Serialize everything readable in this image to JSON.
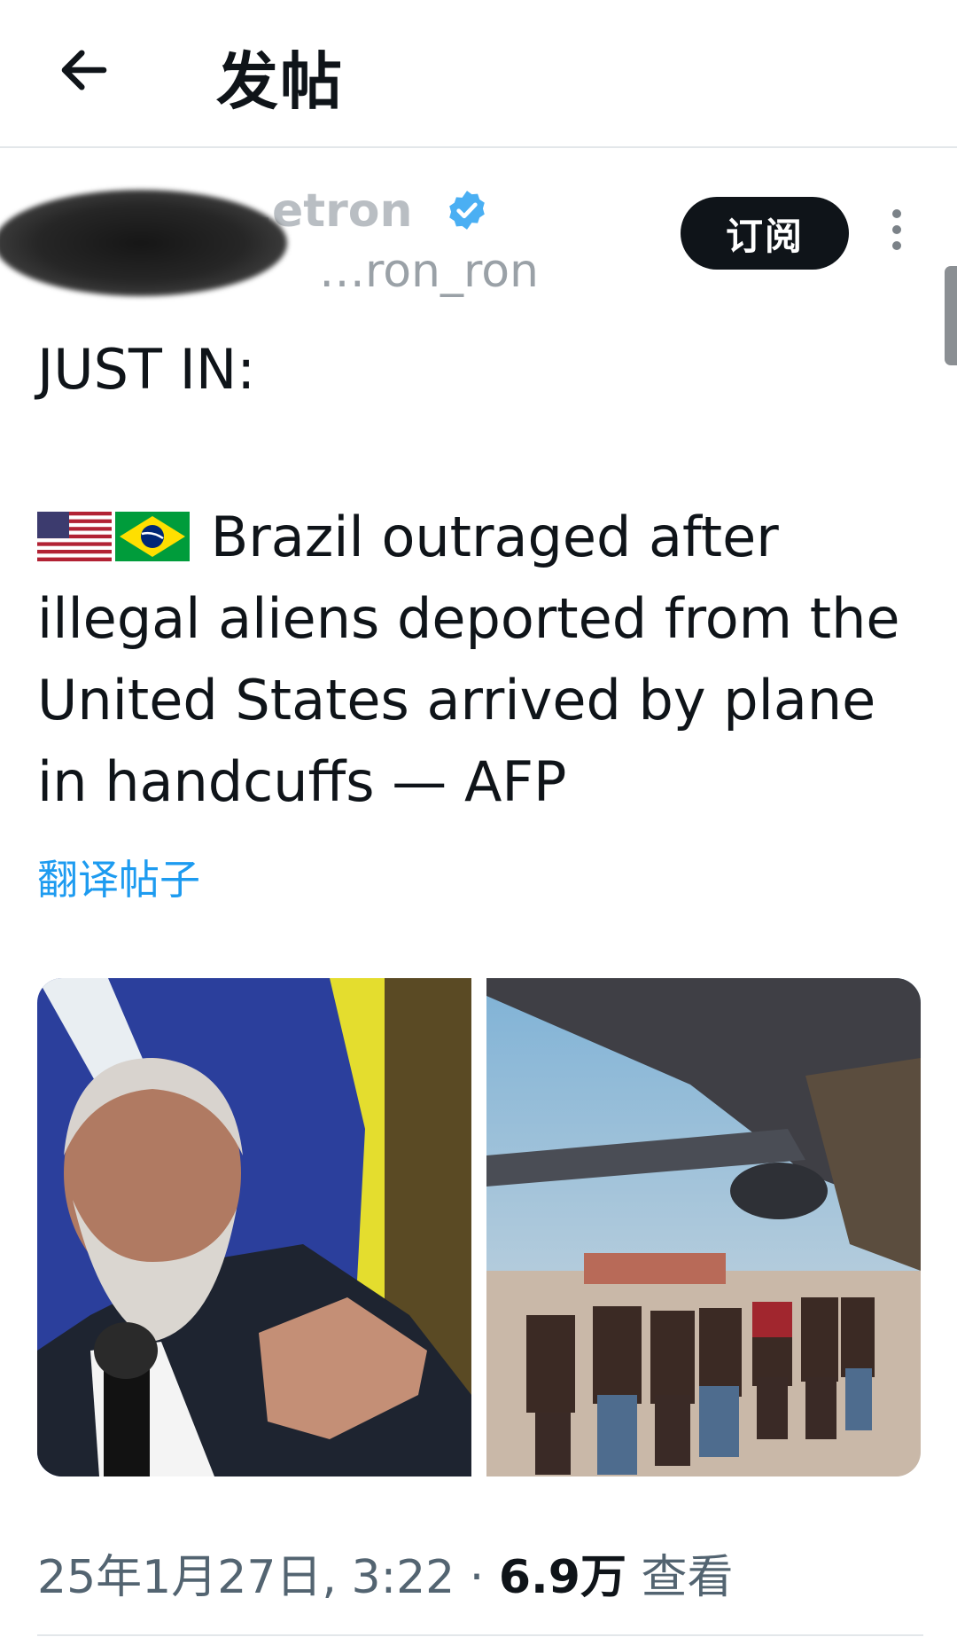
{
  "header": {
    "title": "发帖",
    "back_icon": "arrow-left-icon"
  },
  "author": {
    "name": "…etron",
    "handle": "…ron_ron",
    "verified": true,
    "verified_color": "#1d9bf0"
  },
  "actions": {
    "subscribe_label": "订阅",
    "more_icon": "more-vertical-icon"
  },
  "post": {
    "line1": "JUST IN:",
    "flags": [
      "us-flag",
      "brazil-flag"
    ],
    "text": "Brazil outraged after illegal aliens deported from the United States arrived by plane in handcuffs — AFP",
    "translate_label": "翻译帖子"
  },
  "media": [
    {
      "name": "photo-lula-speaking"
    },
    {
      "name": "photo-deportees-boarding-plane"
    }
  ],
  "meta": {
    "datetime": "25年1月27日, 3:22",
    "separator": "·",
    "views_count": "6.9万",
    "views_label": "查看"
  },
  "colors": {
    "link": "#1d9bf0",
    "text": "#0f1419",
    "muted": "#536471"
  }
}
